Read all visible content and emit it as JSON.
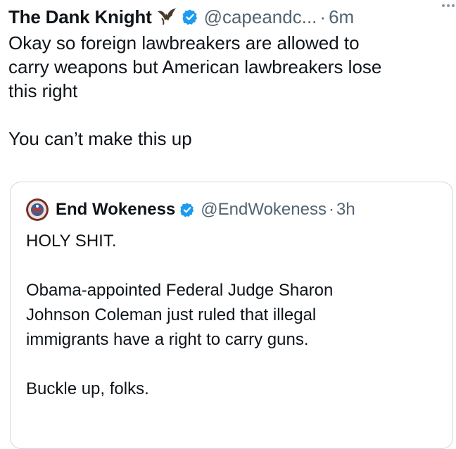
{
  "tweet": {
    "author_name": "The Dank Knight",
    "author_handle": "@capeandc...",
    "separator": "·",
    "time": "6m",
    "text": "Okay so foreign lawbreakers are allowed to\ncarry weapons but American lawbreakers lose\nthis right\n\nYou can’t make this up",
    "name_icon": "bat-icon",
    "verified_icon": "verified-badge-icon",
    "menu_icon": "more-options-icon"
  },
  "quoted": {
    "author_name": "End Wokeness",
    "author_handle": "@EndWokeness",
    "separator": "·",
    "time": "3h",
    "avatar_icon": "round-seal-avatar",
    "verified_icon": "verified-badge-icon",
    "text": "HOLY SHIT.\n\nObama-appointed Federal Judge Sharon\nJohnson Coleman just ruled that illegal\nimmigrants have a right to carry guns.\n\nBuckle up, folks."
  },
  "colors": {
    "text": "#0f1419",
    "muted": "#536471",
    "verified": "#1d9bf0",
    "border": "#cfd9de"
  }
}
